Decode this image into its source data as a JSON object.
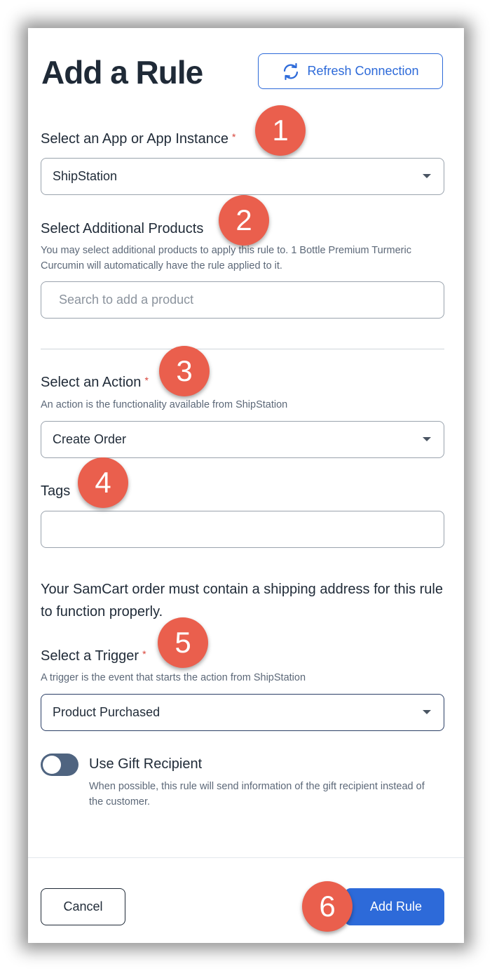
{
  "modal": {
    "title": "Add a Rule",
    "refresh_label": "Refresh Connection"
  },
  "app_field": {
    "label": "Select an App or App Instance",
    "required_mark": "*",
    "value": "ShipStation"
  },
  "products_field": {
    "label": "Select Additional Products",
    "help": "You may select additional products to apply this rule to. 1 Bottle Premium Turmeric Curcumin will automatically have the rule applied to it.",
    "placeholder": "Search to add a product"
  },
  "action_field": {
    "label": "Select an Action",
    "required_mark": "*",
    "help": "An action is the functionality available from ShipStation",
    "value": "Create Order"
  },
  "tags_field": {
    "label": "Tags",
    "value": ""
  },
  "notice": "Your SamCart order must contain a shipping address for this rule to function properly.",
  "trigger_field": {
    "label": "Select a Trigger",
    "required_mark": "*",
    "help": "A trigger is the event that starts the action from ShipStation",
    "value": "Product Purchased"
  },
  "gift_toggle": {
    "label": "Use Gift Recipient",
    "help": "When possible, this rule will send information of the gift recipient instead of the customer.",
    "enabled": false
  },
  "footer": {
    "cancel_label": "Cancel",
    "add_label": "Add Rule"
  },
  "annotations": [
    "1",
    "2",
    "3",
    "4",
    "5",
    "6"
  ],
  "colors": {
    "accent": "#2d6ad9",
    "badge": "#ea5f4d",
    "required": "#d9453b",
    "toggle_off": "#4f6480"
  }
}
